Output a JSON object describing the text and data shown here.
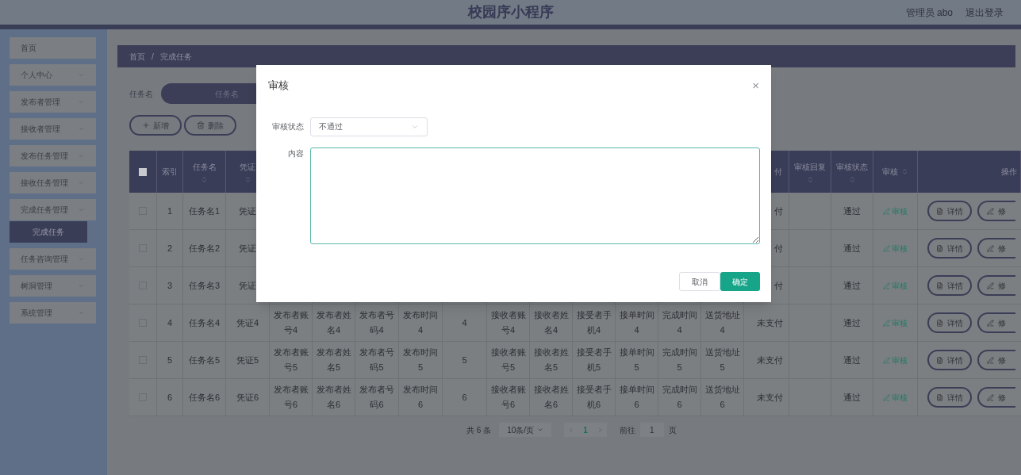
{
  "header": {
    "title": "校园序小程序",
    "user": "管理员 abo",
    "logout": "退出登录"
  },
  "sidebar": {
    "items": [
      {
        "label": "首页"
      },
      {
        "label": "个人中心"
      },
      {
        "label": "发布者管理"
      },
      {
        "label": "接收者管理"
      },
      {
        "label": "发布任务管理"
      },
      {
        "label": "接收任务管理"
      },
      {
        "label": "完成任务管理",
        "children": [
          {
            "label": "完成任务",
            "selected": true
          }
        ]
      },
      {
        "label": "任务咨询管理"
      },
      {
        "label": "树洞管理"
      },
      {
        "label": "系统管理"
      }
    ]
  },
  "breadcrumb": {
    "items": [
      "首页",
      "完成任务"
    ],
    "separator": "/"
  },
  "search": {
    "label": "任务名",
    "placeholder": "任务名"
  },
  "toolbar": [
    "新增",
    "删除"
  ],
  "table": {
    "select_all": {
      "checked": false
    },
    "columns_left": [
      "索引",
      "任务名",
      "凭证"
    ],
    "columns_right": [
      "付",
      "审核回复",
      "审核状态",
      "审核",
      "操作"
    ],
    "rows": [
      {
        "checked": false,
        "index": "1",
        "task": "任务名1",
        "voucher": "凭证",
        "payment": "付",
        "status": "通过",
        "review": "审核",
        "actions": [
          "详情",
          "修"
        ]
      },
      {
        "checked": false,
        "index": "2",
        "task": "任务名2",
        "voucher": "凭证",
        "payment": "付",
        "status": "通过",
        "review": "审核",
        "actions": [
          "详情",
          "修"
        ]
      },
      {
        "checked": false,
        "index": "3",
        "task": "任务名3",
        "voucher": "凭证",
        "payment": "付",
        "status": "通过",
        "review": "审核",
        "actions": [
          "详情",
          "修"
        ]
      },
      {
        "checked": false,
        "index": "4",
        "task": "任务名4",
        "voucher": "凭证4",
        "middle": [
          "发布者账号4",
          "发布者姓名4",
          "发布者号码4",
          "发布时间4",
          "4",
          "接收者账号4",
          "接收者姓名4",
          "接受者手机4",
          "接单时间4",
          "完成时间4",
          "送货地址4"
        ],
        "payment": "未支付",
        "status": "通过",
        "review": "审核",
        "actions": [
          "详情",
          "修"
        ]
      },
      {
        "checked": false,
        "index": "5",
        "task": "任务名5",
        "voucher": "凭证5",
        "middle": [
          "发布者账号5",
          "发布者姓名5",
          "发布者号码5",
          "发布时间5",
          "5",
          "接收者账号5",
          "接收者姓名5",
          "接受者手机5",
          "接单时间5",
          "完成时间5",
          "送货地址5"
        ],
        "payment": "未支付",
        "status": "通过",
        "review": "审核",
        "actions": [
          "详情",
          "修"
        ]
      },
      {
        "checked": false,
        "index": "6",
        "task": "任务名6",
        "voucher": "凭证6",
        "middle": [
          "发布者账号6",
          "发布者姓名6",
          "发布者号码6",
          "发布时间6",
          "6",
          "接收者账号6",
          "接收者姓名6",
          "接受者手机6",
          "接单时间6",
          "完成时间6",
          "送货地址6"
        ],
        "payment": "未支付",
        "status": "通过",
        "review": "审核",
        "actions": [
          "详情",
          "修"
        ]
      }
    ]
  },
  "pagination": {
    "total": "共 6 条",
    "page_size": "10条/页",
    "pages": [
      {
        "label": "1",
        "selected": true
      }
    ],
    "goto_label": "前往",
    "goto_value": "1",
    "goto_suffix": "页"
  },
  "dialog": {
    "title": "审核",
    "close": "×",
    "fields": [
      {
        "kind": "select",
        "label": "审核状态",
        "value": "不通过"
      },
      {
        "kind": "textarea",
        "label": "内容"
      }
    ],
    "buttons": [
      {
        "kind": "secondary",
        "label": "取消"
      },
      {
        "kind": "primary",
        "label": "确定"
      }
    ]
  }
}
